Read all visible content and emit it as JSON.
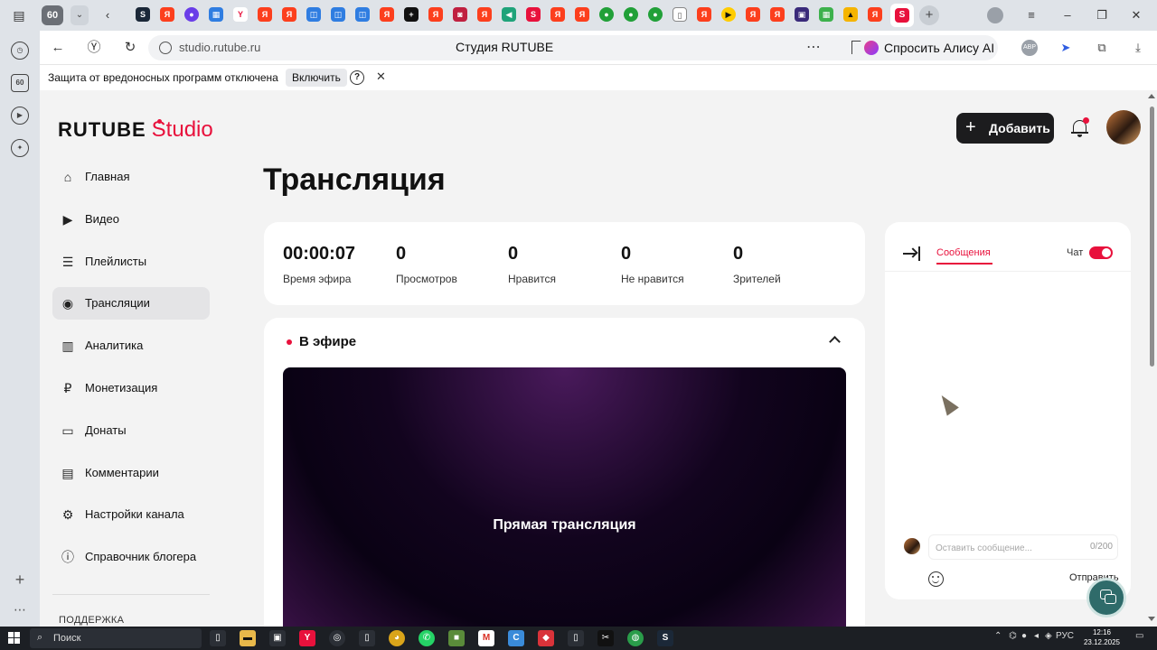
{
  "browser": {
    "tab_count": "60",
    "url": "studio.rutube.ru",
    "title": "Студия RUTUBE",
    "alice_label": "Спросить Алису AI",
    "ext_abp": "ABP"
  },
  "security_bar": {
    "message": "Защита от вредоносных программ отключена",
    "enable_label": "Включить",
    "help_label": "?",
    "close_label": "✕"
  },
  "header": {
    "logo_main": "RUTUBE",
    "logo_sub": "Studio",
    "add_label": "Добавить"
  },
  "sidebar": {
    "items": [
      {
        "label": "Главная",
        "icon": "home-icon",
        "glyph": "⌂"
      },
      {
        "label": "Видео",
        "icon": "video-icon",
        "glyph": "▶"
      },
      {
        "label": "Плейлисты",
        "icon": "playlist-icon",
        "glyph": "☰"
      },
      {
        "label": "Трансляции",
        "icon": "broadcast-icon",
        "glyph": "◉"
      },
      {
        "label": "Аналитика",
        "icon": "analytics-icon",
        "glyph": "▥"
      },
      {
        "label": "Монетизация",
        "icon": "ruble-icon",
        "glyph": "₽"
      },
      {
        "label": "Донаты",
        "icon": "wallet-icon",
        "glyph": "▭"
      },
      {
        "label": "Комментарии",
        "icon": "comment-icon",
        "glyph": "▤"
      },
      {
        "label": "Настройки канала",
        "icon": "gear-icon",
        "glyph": "⚙"
      },
      {
        "label": "Справочник блогера",
        "icon": "info-icon",
        "glyph": "ⓘ"
      }
    ],
    "active_index": 3,
    "support_label": "ПОДДЕРЖКА"
  },
  "main": {
    "title": "Трансляция",
    "stats": [
      {
        "value": "00:00:07",
        "label": "Время эфира"
      },
      {
        "value": "0",
        "label": "Просмотров"
      },
      {
        "value": "0",
        "label": "Нравится"
      },
      {
        "value": "0",
        "label": "Не нравится"
      },
      {
        "value": "0",
        "label": "Зрителей"
      }
    ],
    "live": {
      "title": "В эфире",
      "player_text": "Прямая трансляция"
    }
  },
  "chat": {
    "tab_messages": "Сообщения",
    "chat_label": "Чат",
    "chat_enabled": true,
    "input_placeholder": "Оставить сообщение...",
    "counter": "0/200",
    "send_label": "Отправить"
  },
  "taskbar": {
    "search_label": "Поиск",
    "lang": "РУС",
    "time": "12:16",
    "date": "23.12.2025"
  },
  "colors": {
    "accent": "#e8113c",
    "dark_button": "#1c1c1e",
    "page_bg": "#f3f3f3"
  }
}
